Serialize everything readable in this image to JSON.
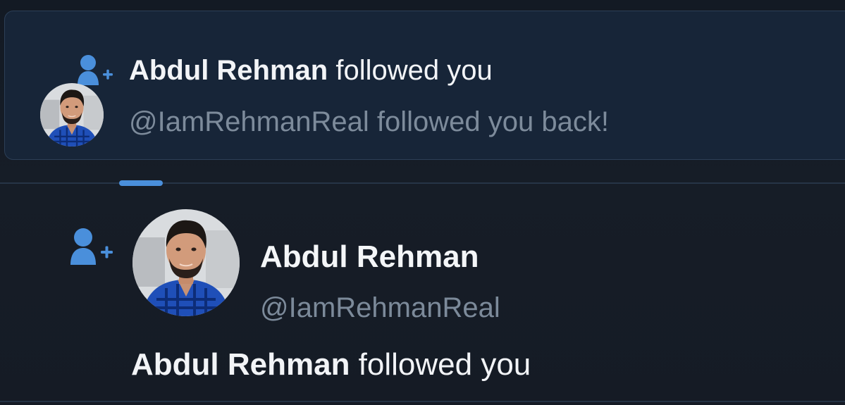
{
  "colors": {
    "accent": "#4a8fdb",
    "background": "#141c26",
    "card_background": "#172538",
    "primary_text": "#f2f4f7",
    "secondary_text": "#7d8b9b"
  },
  "notification": {
    "icon": "add-user-icon",
    "avatar": "user-avatar",
    "name": "Abdul Rehman",
    "action": " followed you",
    "subtitle": "@IamRehmanReal followed you back!"
  },
  "follow_item": {
    "icon": "add-user-icon",
    "avatar": "user-avatar",
    "display_name": "Abdul Rehman",
    "handle": "@IamRehmanReal",
    "message_name": "Abdul Rehman",
    "message_action": " followed you"
  }
}
